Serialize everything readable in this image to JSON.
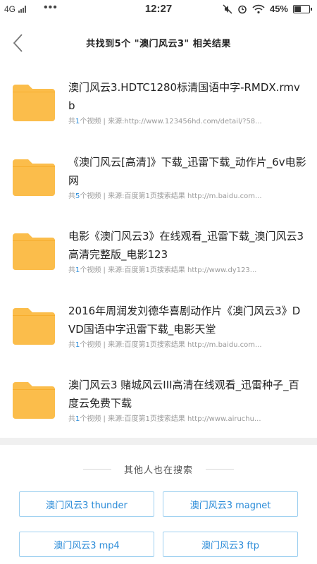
{
  "status": {
    "network": "4G",
    "dots": "•••",
    "time": "12:27",
    "battery_text": "45%",
    "battery_level": 0.45
  },
  "header": {
    "title": "共找到5个 \"澳门风云3\" 相关结果"
  },
  "results": [
    {
      "title": "澳门风云3.HDTC1280标清国语中字-RMDX.rmvb",
      "count_prefix": "共",
      "count": "1",
      "count_suffix": "个视频",
      "source": " | 来源:http://www.123456hd.com/detail/?58..."
    },
    {
      "title": "《澳门风云[高清]》下载_迅雷下载_动作片_6v电影网",
      "count_prefix": "共",
      "count": "5",
      "count_suffix": "个视频",
      "source": " | 来源:百度第1页搜索结果 http://m.baidu.com..."
    },
    {
      "title": "电影《澳门风云3》在线观看_迅雷下载_澳门风云3高清完整版_电影123",
      "count_prefix": "共",
      "count": "1",
      "count_suffix": "个视频",
      "source": " | 来源:百度第1页搜索结果 http://www.dy123..."
    },
    {
      "title": "2016年周润发刘德华喜剧动作片《澳门风云3》DVD国语中字迅雷下载_电影天堂",
      "count_prefix": "共",
      "count": "1",
      "count_suffix": "个视频",
      "source": " | 来源:百度第1页搜索结果 http://m.baidu.com..."
    },
    {
      "title": "澳门风云3 赌城风云III高清在线观看_迅雷种子_百度云免费下载",
      "count_prefix": "共",
      "count": "1",
      "count_suffix": "个视频",
      "source": " | 来源:百度第1页搜索结果 http://www.airuchu..."
    }
  ],
  "others": {
    "heading": "其他人也在搜索",
    "suggestions": [
      "澳门风云3 thunder",
      "澳门风云3 magnet",
      "澳门风云3 mp4",
      "澳门风云3 ftp"
    ]
  },
  "colors": {
    "folder": "#fbbd4b",
    "accent": "#2a8bd8",
    "button_border": "#9ed0f0",
    "meta_text": "#9a9a9a"
  },
  "icons": {
    "back": "chevron-left-icon",
    "folder": "folder-icon",
    "mute": "mute-icon",
    "alarm": "alarm-icon",
    "wifi": "wifi-icon",
    "battery": "battery-icon"
  }
}
